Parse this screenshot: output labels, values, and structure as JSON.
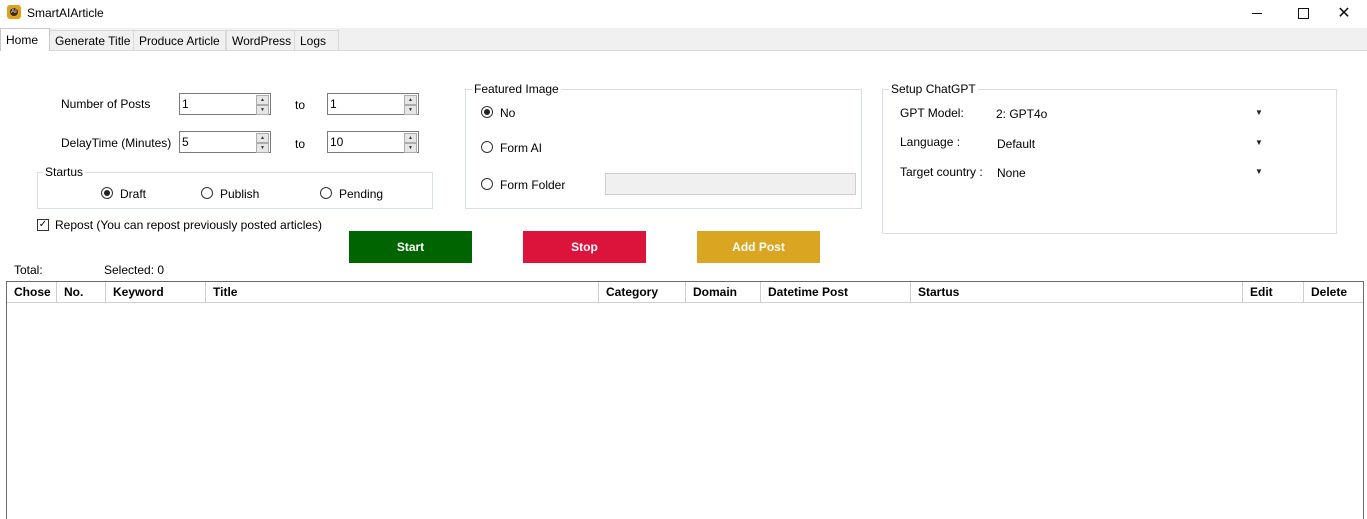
{
  "window": {
    "title": "SmartAIArticle",
    "minimize_icon": "minimize-icon",
    "maximize_icon": "maximize-icon",
    "close_icon": "close-icon"
  },
  "tabs": [
    {
      "label": "Home",
      "active": true
    },
    {
      "label": "Generate Title"
    },
    {
      "label": "Produce Article"
    },
    {
      "label": "WordPress"
    },
    {
      "label": "Logs"
    }
  ],
  "posts": {
    "number_label": "Number of Posts",
    "number_from": "1",
    "number_to": "1",
    "delay_label": "DelayTime (Minutes)",
    "delay_from": "5",
    "delay_to": "10",
    "to_label": "to"
  },
  "status_group": {
    "legend": "Startus",
    "options": [
      {
        "label": "Draft",
        "checked": true
      },
      {
        "label": "Publish",
        "checked": false
      },
      {
        "label": "Pending",
        "checked": false
      }
    ]
  },
  "repost": {
    "label": "Repost (You can repost previously posted articles)",
    "checked": true
  },
  "featured_image": {
    "legend": "Featured Image",
    "options": [
      {
        "label": "No",
        "checked": true
      },
      {
        "label": "Form AI",
        "checked": false
      },
      {
        "label": "Form Folder",
        "checked": false
      }
    ],
    "folder_value": ""
  },
  "chatgpt": {
    "legend": "Setup ChatGPT",
    "model_label": "GPT Model:",
    "model_value": "2: GPT4o",
    "language_label": "Language :",
    "language_value": "Default",
    "country_label": "Target country :",
    "country_value": "None"
  },
  "actions": {
    "start": "Start",
    "stop": "Stop",
    "add_post": "Add Post",
    "colors": {
      "start": "#006400",
      "stop": "#dc143c",
      "add_post": "#daa520"
    }
  },
  "summary": {
    "total": "Total:",
    "selected": "Selected: 0"
  },
  "table": {
    "columns": [
      "Chose",
      "No.",
      "Keyword",
      "Title",
      "Category",
      "Domain",
      "Datetime Post",
      "Startus",
      "Edit",
      "Delete"
    ],
    "rows": []
  }
}
